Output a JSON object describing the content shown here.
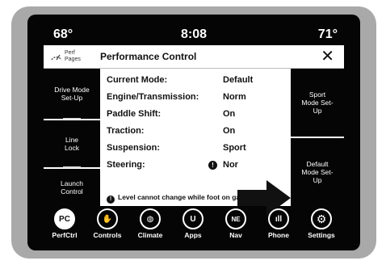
{
  "status": {
    "temp_left": "68°",
    "time": "8:08",
    "temp_right": "71°"
  },
  "header": {
    "logo_line1": "Perf",
    "logo_line2": "Pages",
    "title": "Performance Control",
    "close": "✕"
  },
  "left_buttons": [
    {
      "label": "Drive Mode Set-Up"
    },
    {
      "label": "Line Lock"
    },
    {
      "label": "Launch Control"
    }
  ],
  "settings": [
    {
      "key": "Current Mode:",
      "value": "Default"
    },
    {
      "key": "Engine/Transmission:",
      "value": "Norm"
    },
    {
      "key": "Paddle Shift:",
      "value": "On"
    },
    {
      "key": "Traction:",
      "value": "On"
    },
    {
      "key": "Suspension:",
      "value": "Sport"
    },
    {
      "key": "Steering:",
      "value": "Nor"
    }
  ],
  "note": "Level cannot change while foot on gas",
  "right_buttons": [
    {
      "label": "Sport Mode Set-Up"
    },
    {
      "label": "Default Mode Set-Up"
    }
  ],
  "nav": [
    {
      "label": "PerfCtrl",
      "icon": "perf-control-icon",
      "glyph": "PC"
    },
    {
      "label": "Controls",
      "icon": "controls-icon",
      "glyph": "✋"
    },
    {
      "label": "Climate",
      "icon": "climate-icon",
      "glyph": "◍"
    },
    {
      "label": "Apps",
      "icon": "apps-icon",
      "glyph": "U"
    },
    {
      "label": "Nav",
      "icon": "compass-icon",
      "glyph": "NE"
    },
    {
      "label": "Phone",
      "icon": "phone-signal-icon",
      "glyph": "ıll"
    },
    {
      "label": "Settings",
      "icon": "gear-icon",
      "glyph": "⚙"
    }
  ],
  "colors": {
    "screen_bg": "#050505",
    "panel_bg": "#ffffff",
    "frame": "#a9a9a9"
  }
}
